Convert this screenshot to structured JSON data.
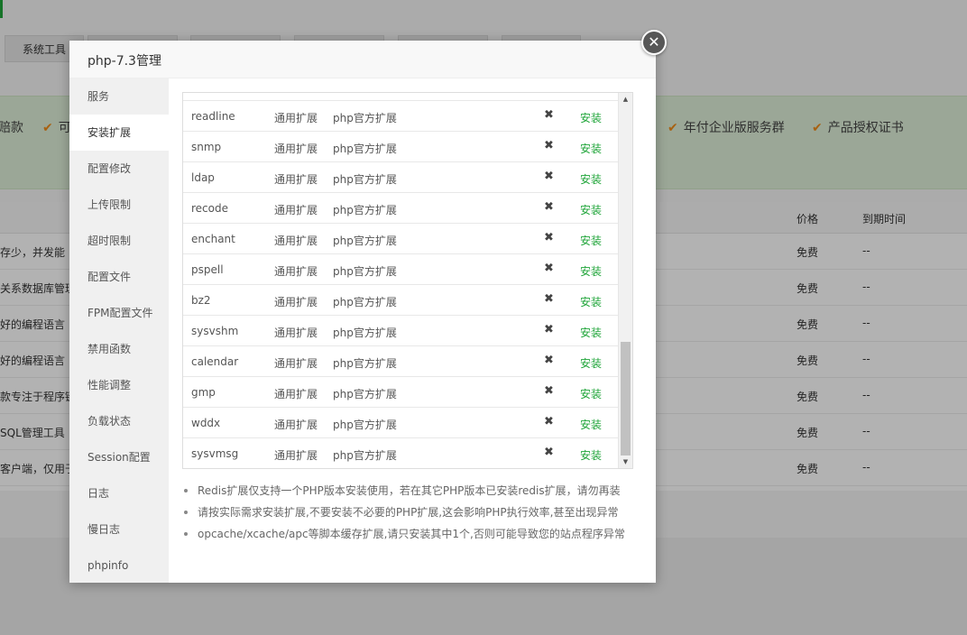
{
  "background": {
    "toolbar_tab": "系统工具",
    "banner_items": [
      "年付企业版服务群",
      "产品授权证书"
    ],
    "banner_partial": [
      "赔款",
      "可"
    ],
    "table_headers": {
      "price": "价格",
      "expire": "到期时间"
    },
    "rows": [
      {
        "desc": "存少，并发能",
        "price": "免费",
        "expire": "--"
      },
      {
        "desc": "关系数据库管理",
        "price": "免费",
        "expire": "--"
      },
      {
        "desc": "好的编程语言",
        "price": "免费",
        "expire": "--"
      },
      {
        "desc": "好的编程语言",
        "price": "免费",
        "expire": "--"
      },
      {
        "desc": "款专注于程序键",
        "price": "免费",
        "expire": "--"
      },
      {
        "desc": "SQL管理工具",
        "price": "免费",
        "expire": "--"
      },
      {
        "desc": "客户端，仅用于",
        "price": "免费",
        "expire": "--"
      }
    ]
  },
  "modal": {
    "title": "php-7.3管理",
    "close_icon": "✕",
    "sidebar": [
      "服务",
      "安装扩展",
      "配置修改",
      "上传限制",
      "超时限制",
      "配置文件",
      "FPM配置文件",
      "禁用函数",
      "性能调整",
      "负载状态",
      "Session配置",
      "日志",
      "慢日志",
      "phpinfo"
    ],
    "active_index": 1,
    "extensions": [
      {
        "name": "readline",
        "type": "通用扩展",
        "desc": "php官方扩展",
        "status": "✖",
        "action": "安装"
      },
      {
        "name": "snmp",
        "type": "通用扩展",
        "desc": "php官方扩展",
        "status": "✖",
        "action": "安装"
      },
      {
        "name": "ldap",
        "type": "通用扩展",
        "desc": "php官方扩展",
        "status": "✖",
        "action": "安装"
      },
      {
        "name": "recode",
        "type": "通用扩展",
        "desc": "php官方扩展",
        "status": "✖",
        "action": "安装"
      },
      {
        "name": "enchant",
        "type": "通用扩展",
        "desc": "php官方扩展",
        "status": "✖",
        "action": "安装"
      },
      {
        "name": "pspell",
        "type": "通用扩展",
        "desc": "php官方扩展",
        "status": "✖",
        "action": "安装"
      },
      {
        "name": "bz2",
        "type": "通用扩展",
        "desc": "php官方扩展",
        "status": "✖",
        "action": "安装"
      },
      {
        "name": "sysvshm",
        "type": "通用扩展",
        "desc": "php官方扩展",
        "status": "✖",
        "action": "安装"
      },
      {
        "name": "calendar",
        "type": "通用扩展",
        "desc": "php官方扩展",
        "status": "✖",
        "action": "安装"
      },
      {
        "name": "gmp",
        "type": "通用扩展",
        "desc": "php官方扩展",
        "status": "✖",
        "action": "安装"
      },
      {
        "name": "wddx",
        "type": "通用扩展",
        "desc": "php官方扩展",
        "status": "✖",
        "action": "安装"
      },
      {
        "name": "sysvmsg",
        "type": "通用扩展",
        "desc": "php官方扩展",
        "status": "✖",
        "action": "安装"
      }
    ],
    "notes": [
      "Redis扩展仅支持一个PHP版本安装使用，若在其它PHP版本已安装redis扩展，请勿再装",
      "请按实际需求安装扩展,不要安装不必要的PHP扩展,这会影响PHP执行效率,甚至出现异常",
      "opcache/xcache/apc等脚本缓存扩展,请只安装其中1个,否则可能导致您的站点程序异常"
    ]
  },
  "colors": {
    "accent": "#20a53a",
    "banner_check": "#f08c1a"
  }
}
